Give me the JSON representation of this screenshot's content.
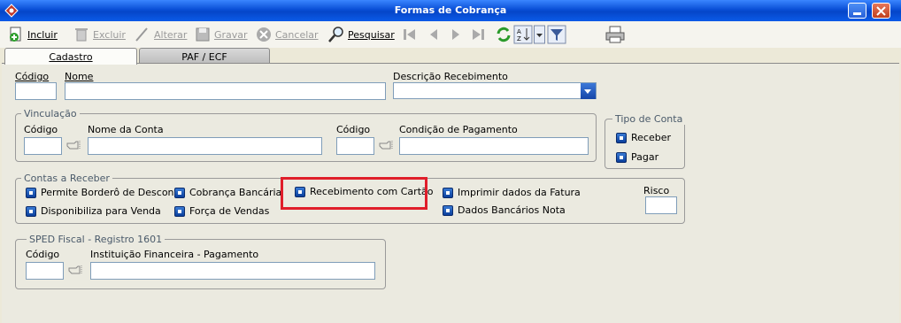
{
  "window": {
    "title": "Formas de Cobrança"
  },
  "toolbar": {
    "incluir": "Incluir",
    "excluir": "Excluir",
    "alterar": "Alterar",
    "gravar": "Gravar",
    "cancelar": "Cancelar",
    "pesquisar": "Pesquisar"
  },
  "tabs": {
    "cadastro": "Cadastro",
    "paf": "PAF / ECF"
  },
  "form": {
    "codigo_label": "Código",
    "nome_label": "Nome",
    "descricao_label": "Descrição Recebimento"
  },
  "vinculacao": {
    "legend": "Vinculação",
    "codigo_label": "Código",
    "nome_conta_label": "Nome da Conta",
    "codigo2_label": "Código",
    "condicao_label": "Condição de Pagamento"
  },
  "tipo_conta": {
    "legend": "Tipo de Conta",
    "receber": "Receber",
    "pagar": "Pagar"
  },
  "contas_receber": {
    "legend": "Contas a Receber",
    "bordero": "Permite Borderô de Desconto",
    "disponibiliza": "Disponibiliza para Venda",
    "cobranca": "Cobrança Bancária",
    "forca": "Força de Vendas",
    "cartao": "Recebimento com Cartão",
    "imprimir": "Imprimir dados da Fatura",
    "dados_bancarios": "Dados Bancários Nota",
    "risco_label": "Risco"
  },
  "sped": {
    "legend": "SPED Fiscal - Registro 1601",
    "codigo_label": "Código",
    "instituicao_label": "Instituição Financeira - Pagamento"
  },
  "colors": {
    "highlight": "#e01e2a",
    "accent": "#0a4fd6"
  }
}
